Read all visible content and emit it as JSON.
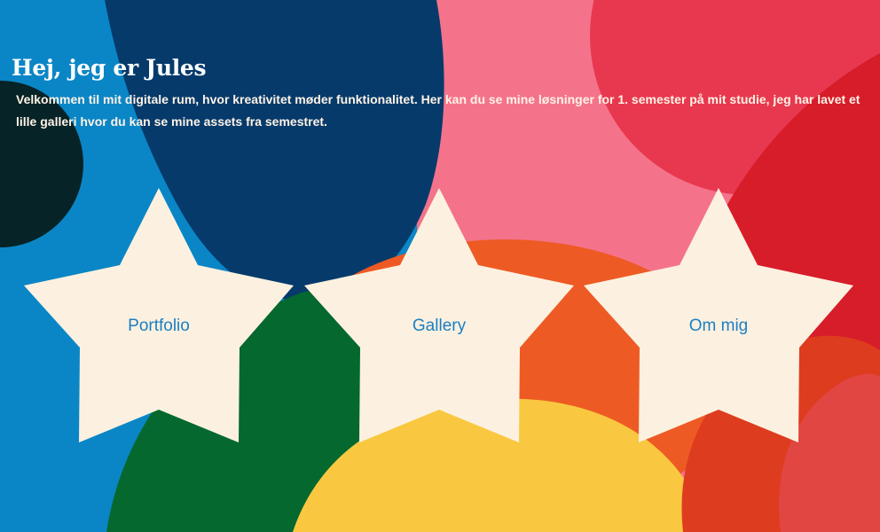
{
  "page": {
    "heading": "Hej, jeg er Jules",
    "intro": "Velkommen til mit digitale rum, hvor kreativitet møder funktionalitet. Her kan du se mine løsninger for 1. semester på mit studie, jeg har lavet et lille galleri hvor du kan se mine assets fra semestret."
  },
  "nav": {
    "items": [
      {
        "label": "Portfolio"
      },
      {
        "label": "Gallery"
      },
      {
        "label": "Om mig"
      }
    ]
  },
  "colors": {
    "sky_blue": "#0a86c6",
    "navy": "#063a6b",
    "pink": "#f4738b",
    "red": "#e0363f",
    "orange": "#ee5a24",
    "yellow": "#f9c840",
    "green": "#05682e",
    "dark": "#062327",
    "star_fill": "#fcf1e0",
    "link_text": "#1b7fc4"
  }
}
